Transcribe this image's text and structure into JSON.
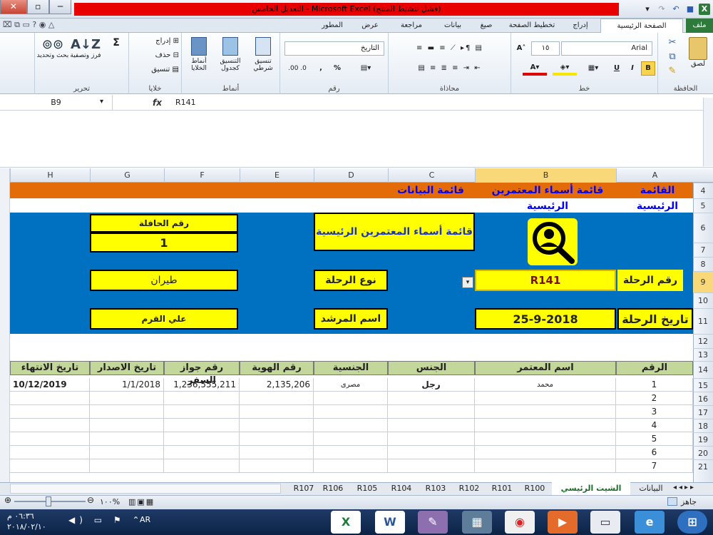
{
  "window": {
    "title": "التعديل الخامس - Microsoft Excel (فشل تنشيط المنتج)",
    "min": "─",
    "max": "▫",
    "close": "✕"
  },
  "qat": {
    "save": "■",
    "undo": "↶",
    "redo": "↷",
    "dropdown": "▾"
  },
  "tabs": {
    "file": "ملف",
    "home": "الصفحة الرئيسية",
    "insert": "إدراج",
    "layout": "تخطيط الصفحة",
    "formulas": "صيغ",
    "data": "بيانات",
    "review": "مراجعة",
    "view": "عرض",
    "developer": "المطور"
  },
  "ribbon": {
    "clipboard": {
      "label": "الحافظة",
      "paste": "لصق"
    },
    "font": {
      "label": "خط",
      "name": "Arial",
      "size": "١٥",
      "bold": "B",
      "italic": "I",
      "underline": "U"
    },
    "alignment": {
      "label": "محاذاة"
    },
    "number": {
      "label": "رقم",
      "format": "التاريخ",
      "percent": "%",
      "comma": ","
    },
    "styles": {
      "label": "أنماط",
      "conditional": "تنسيق شرطي",
      "table": "التنسيق كجدول",
      "cell": "أنماط الخلايا"
    },
    "cells": {
      "label": "خلايا",
      "insert": "إدراج",
      "delete": "حذف",
      "format": "تنسيق"
    },
    "editing": {
      "label": "تحرير",
      "sum": "Σ",
      "sort": "فرز وتصفية",
      "find": "بحث وتحديد"
    }
  },
  "formula_bar": {
    "name_box": "B9",
    "fx": "fx",
    "value": "R141"
  },
  "columns": [
    "A",
    "B",
    "C",
    "D",
    "E",
    "F",
    "G",
    "H"
  ],
  "rows": [
    "4",
    "5",
    "6",
    "7",
    "8",
    "9",
    "10",
    "11",
    "12",
    "13",
    "14",
    "15",
    "16",
    "17",
    "18",
    "19",
    "20",
    "21"
  ],
  "menu": {
    "main": "القائمة الرئيسية",
    "guides": "قائمة أسماء المعتمرين الرئيسية",
    "data": "قائمة البيانات"
  },
  "form": {
    "bus_no_label": "رقم الحافلة",
    "bus_no_value": "1",
    "list_title": "قائمة أسماء المعتمرين الرئيسية",
    "trip_no_label": "رقم الرحلة",
    "trip_no_value": "R141",
    "trip_type_label": "نوع الرحلة",
    "trip_type_value": "طيران",
    "trip_date_label": "تاريخ الرحلة",
    "trip_date_value": "25-9-2018",
    "guide_label": "اسم المرشد",
    "guide_value": "علي القرم"
  },
  "table": {
    "headers": [
      "الرقم",
      "اسم المعتمر",
      "الجنس",
      "الجنسية",
      "رقم الهوية",
      "رقم جواز السفر",
      "تاريخ الاصدار",
      "تاريخ الانتهاء"
    ],
    "rows": [
      [
        "1",
        "محمد",
        "رجل",
        "مصرى",
        "2,135,206",
        "1,236,555,211",
        "1/1/2018",
        "10/12/2019"
      ],
      [
        "2",
        "",
        "",
        "",
        "",
        "",
        "",
        ""
      ],
      [
        "3",
        "",
        "",
        "",
        "",
        "",
        "",
        ""
      ],
      [
        "4",
        "",
        "",
        "",
        "",
        "",
        "",
        ""
      ],
      [
        "5",
        "",
        "",
        "",
        "",
        "",
        "",
        ""
      ],
      [
        "6",
        "",
        "",
        "",
        "",
        "",
        "",
        ""
      ],
      [
        "7",
        "",
        "",
        "",
        "",
        "",
        "",
        ""
      ]
    ]
  },
  "sheet_tabs": [
    "البيانات",
    "الشيت الرئيسي",
    "R100",
    "R101",
    "R102",
    "R103",
    "R104",
    "R105",
    "R106",
    "R107"
  ],
  "status": {
    "ready": "جاهز",
    "zoom": "١٠٠%"
  },
  "taskbar": {
    "time": "٠٦:٣٦ م",
    "date": "٢٠١٨/٠٢/١٠",
    "lang": "AR"
  },
  "colors": {
    "accent_green": "#2d7a3a",
    "header_orange": "#e36c09",
    "form_blue": "#0070c0",
    "field_yellow": "#ffff00",
    "table_header": "#c4d79b"
  }
}
